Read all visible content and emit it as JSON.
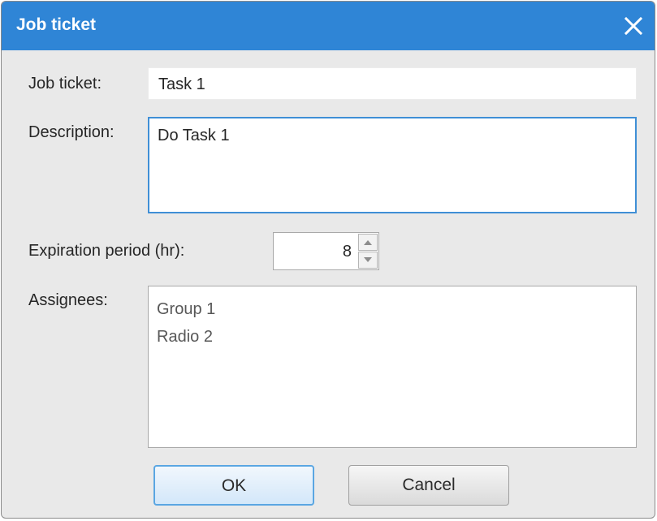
{
  "dialog": {
    "title": "Job ticket",
    "close_icon": "close-icon"
  },
  "form": {
    "job_ticket_label": "Job ticket:",
    "job_ticket_value": "Task 1",
    "description_label": "Description:",
    "description_value": "Do Task 1",
    "expiration_label": "Expiration period (hr):",
    "expiration_value": "8",
    "assignees_label": "Assignees:",
    "assignees": [
      {
        "label": "Group 1"
      },
      {
        "label": "Radio 2"
      }
    ]
  },
  "buttons": {
    "ok_label": "OK",
    "cancel_label": "Cancel"
  },
  "colors": {
    "titlebar": "#2f85d6",
    "dialog_bg": "#e9e9e9",
    "focus_border": "#3f8fd6"
  }
}
